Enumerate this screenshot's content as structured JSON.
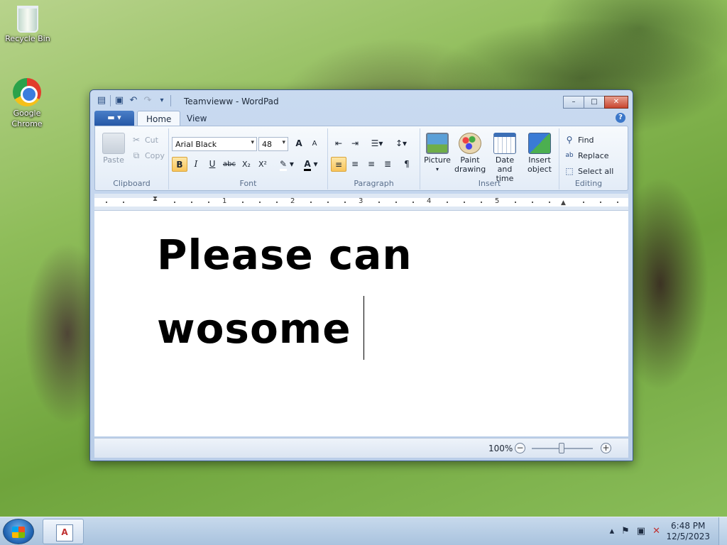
{
  "desktop": {
    "icons": [
      {
        "label": "Recycle Bin"
      },
      {
        "label": "Google Chrome"
      }
    ]
  },
  "window": {
    "title": "Teamvieww - WordPad",
    "tabs": [
      {
        "label": "Home"
      },
      {
        "label": "View"
      }
    ],
    "caption": {
      "minimize": "–",
      "maximize": "□",
      "close": "✕"
    },
    "help": "?"
  },
  "ribbon": {
    "clipboard": {
      "paste": "Paste",
      "cut": "Cut",
      "copy": "Copy",
      "label": "Clipboard"
    },
    "font": {
      "family": "Arial Black",
      "size": "48",
      "label": "Font",
      "grow": "A",
      "shrink": "A",
      "bold": "B",
      "italic": "I",
      "underline": "U",
      "strike": "abc",
      "subscript": "X₂",
      "superscript": "X²"
    },
    "paragraph": {
      "label": "Paragraph"
    },
    "insert": {
      "picture": "Picture",
      "paint_1": "Paint",
      "paint_2": "drawing",
      "date_1": "Date and",
      "date_2": "time",
      "object_1": "Insert",
      "object_2": "object",
      "label": "Insert"
    },
    "editing": {
      "find": "Find",
      "replace": "Replace",
      "select_all": "Select all",
      "label": "Editing"
    }
  },
  "ruler": {
    "marks": [
      "1",
      "2",
      "3",
      "4",
      "5"
    ]
  },
  "document": {
    "lines": [
      "Please can",
      "wosome"
    ]
  },
  "status": {
    "zoom": "100%",
    "zoom_level_percent": 100
  },
  "taskbar": {
    "time": "6:48 PM",
    "date": "12/5/2023"
  }
}
